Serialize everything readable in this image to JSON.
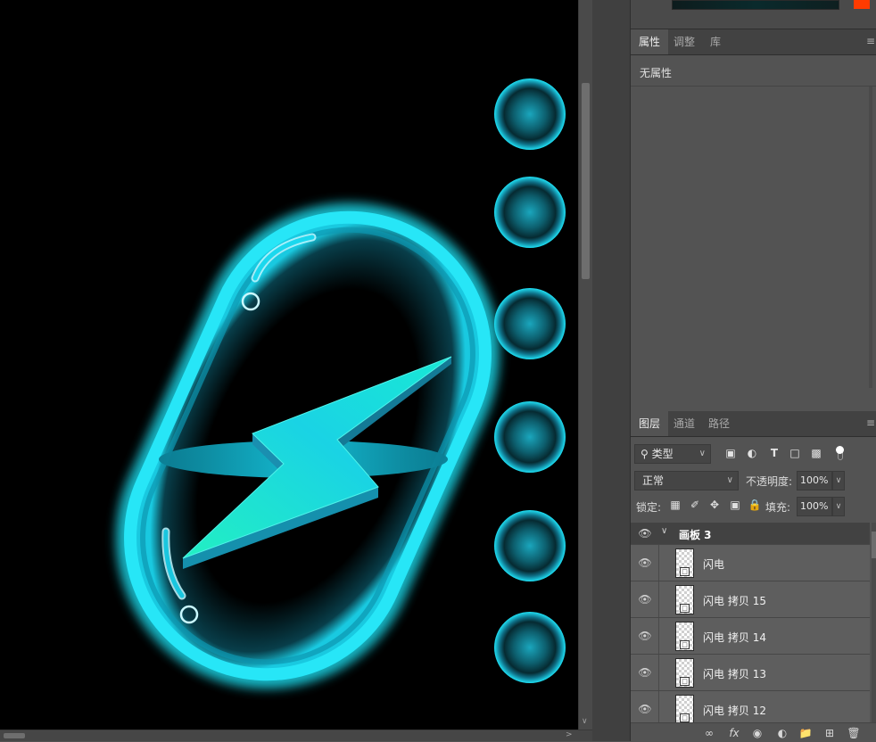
{
  "color_panel": {
    "swatch_color": "#ff3b00"
  },
  "properties_panel": {
    "tabs": [
      {
        "label": "属性",
        "active": true
      },
      {
        "label": "调整",
        "active": false
      },
      {
        "label": "库",
        "active": false
      }
    ],
    "empty_text": "无属性",
    "menu_icon": "panel-menu-icon"
  },
  "layers_panel": {
    "tabs": [
      {
        "label": "图层",
        "active": true
      },
      {
        "label": "通道",
        "active": false
      },
      {
        "label": "路径",
        "active": false
      }
    ],
    "filter": {
      "kind_label": "类型",
      "icons": [
        "image-filter-icon",
        "adjustment-filter-icon",
        "type-filter-icon",
        "shape-filter-icon",
        "smart-object-filter-icon"
      ]
    },
    "blend_mode": "正常",
    "opacity_label": "不透明度:",
    "opacity_value": "100%",
    "lock_label": "锁定:",
    "fill_label": "填充:",
    "fill_value": "100%",
    "group": {
      "name": "画板 3",
      "expanded": true
    },
    "layers": [
      {
        "name": "闪电",
        "copy": "",
        "num": ""
      },
      {
        "name": "闪电",
        "copy": "拷贝",
        "num": "15"
      },
      {
        "name": "闪电",
        "copy": "拷贝",
        "num": "14"
      },
      {
        "name": "闪电",
        "copy": "拷贝",
        "num": "13"
      },
      {
        "name": "闪电",
        "copy": "拷贝",
        "num": "12"
      }
    ],
    "toolbar_icons": [
      "link-icon",
      "fx-icon",
      "mask-icon",
      "adjustment-icon",
      "folder-icon",
      "new-layer-icon",
      "trash-icon"
    ]
  },
  "canvas": {
    "background": "#000000",
    "accent": "#1ee3f5",
    "bolt_top_color": "#19d8e6",
    "bolt_side_color": "#1591b0",
    "orb_count": 6
  }
}
